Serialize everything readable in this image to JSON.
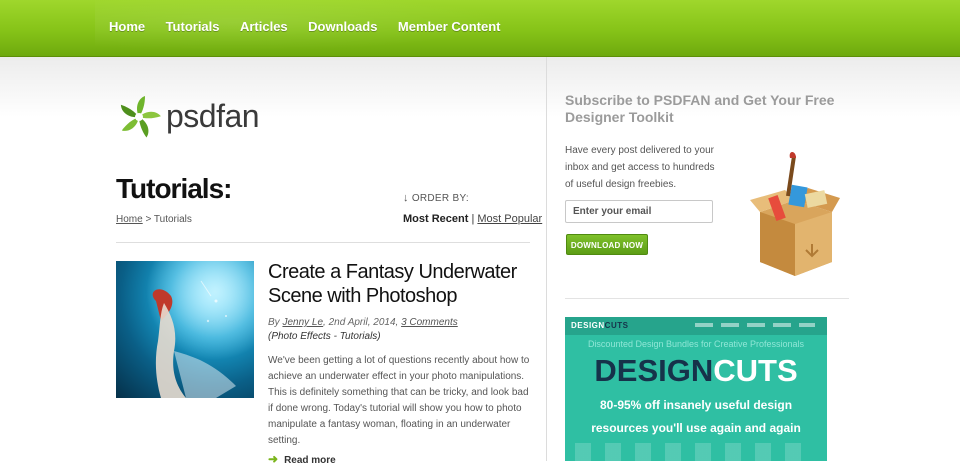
{
  "nav": {
    "items": [
      "Home",
      "Tutorials",
      "Articles",
      "Downloads",
      "Member Content"
    ]
  },
  "logo": {
    "text": "psdfan"
  },
  "page": {
    "title": "Tutorials:",
    "breadcrumb_home": "Home",
    "breadcrumb_sep": " > ",
    "breadcrumb_current": "Tutorials",
    "order_by_label": "ORDER BY:",
    "sort_most_recent": "Most Recent",
    "sort_sep": " | ",
    "sort_most_popular": "Most Popular"
  },
  "article": {
    "title": "Create a Fantasy Underwater Scene with Photoshop",
    "by": "By ",
    "author": "Jenny Le",
    "date": ", 2nd April, 2014, ",
    "comments": "3 Comments",
    "category": "(Photo Effects - Tutorials)",
    "excerpt": "We've been getting a lot of questions recently about how to achieve an underwater effect in your photo manipulations. This is definitely something that can be tricky, and look bad if done wrong. Today's tutorial will show you how to photo manipulate a fantasy woman, floating in an underwater setting.",
    "read_more": "Read more"
  },
  "sidebar": {
    "subscribe_title": "Subscribe to PSDFAN and Get Your Free Designer Toolkit",
    "subscribe_desc": "Have every post delivered to your inbox and get access to hundreds of useful design freebies.",
    "email_placeholder": "Enter your email",
    "download_button": "DOWNLOAD NOW"
  },
  "ad": {
    "brand_a": "DESIGN",
    "brand_b": "CUTS",
    "tagline": "Discounted Design Bundles for Creative Professionals",
    "logo_a": "DESIGN",
    "logo_b": "CUTS",
    "line1": "80-95% off insanely useful design",
    "line2": "resources you'll use again and again"
  },
  "colors": {
    "nav_green": "#86c318",
    "button_green": "#6aab1e",
    "ad_teal": "#2fbfa3",
    "ad_navy": "#16324a"
  },
  "icons": [
    "psdfan-pinwheel-logo-icon",
    "down-arrow-icon",
    "read-more-arrow-icon",
    "designer-toolkit-box-icon"
  ]
}
